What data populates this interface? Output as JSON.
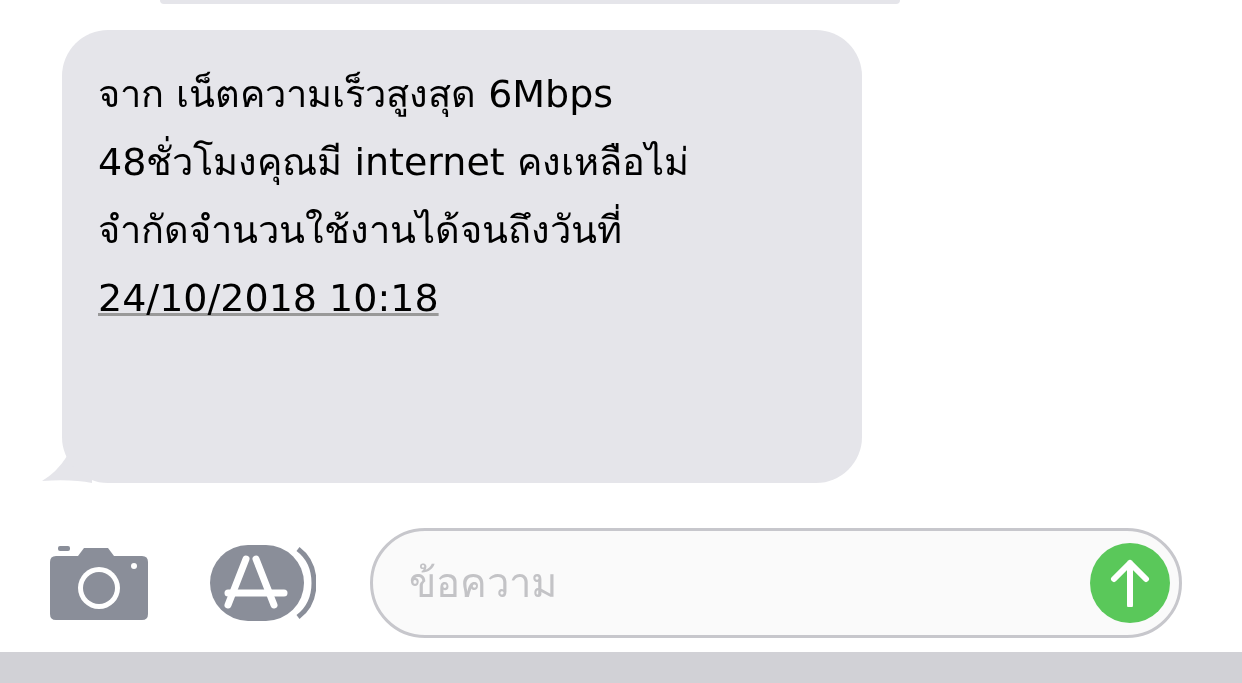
{
  "message": {
    "lines": [
      "จาก เน็ตความเร็วสูงสุด 6Mbps",
      "48ชั่วโมงคุณมี internet คงเหลือไม่",
      "จำกัดจำนวนใช้งานได้จนถึงวันที่"
    ],
    "link": "24/10/2018 10:18"
  },
  "composer": {
    "placeholder": "ข้อความ"
  }
}
